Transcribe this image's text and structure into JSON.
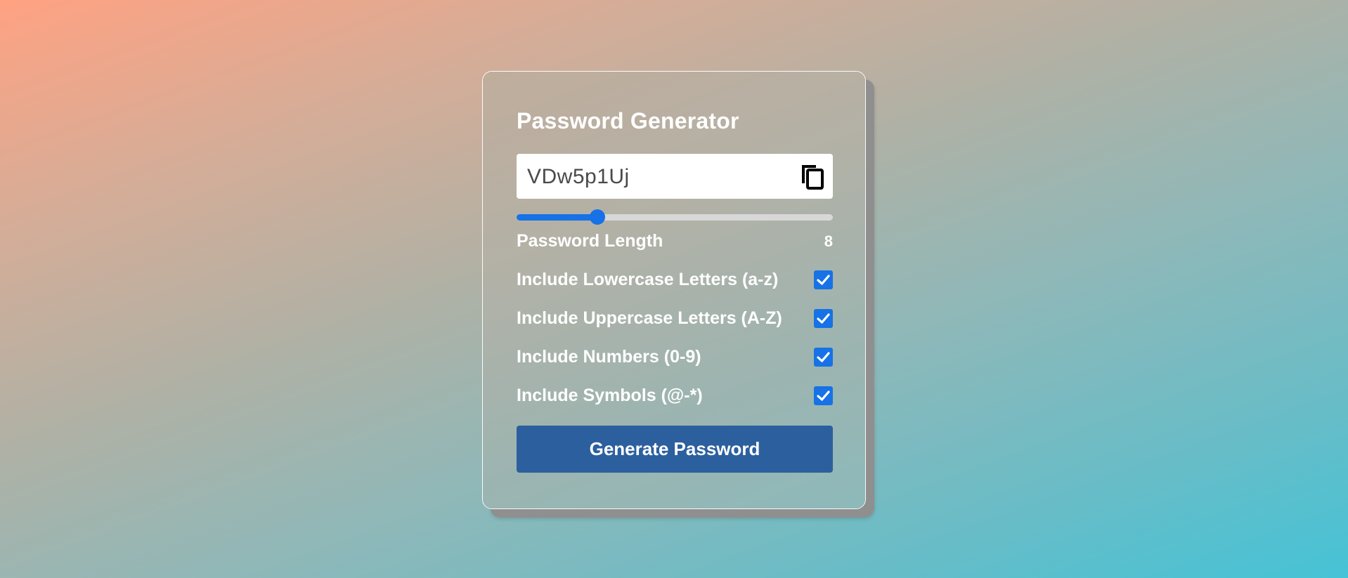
{
  "app": {
    "title": "Password Generator"
  },
  "result": {
    "password": "VDw5p1Uj",
    "copy_icon": "copy-icon"
  },
  "length": {
    "label": "Password Length",
    "value": "8",
    "slider_fraction": 0.255
  },
  "options": [
    {
      "label": "Include Lowercase Letters (a-z)",
      "checked": true
    },
    {
      "label": "Include Uppercase Letters (A-Z)",
      "checked": true
    },
    {
      "label": "Include Numbers (0-9)",
      "checked": true
    },
    {
      "label": "Include Symbols (@-*)",
      "checked": true
    }
  ],
  "actions": {
    "generate_label": "Generate Password"
  },
  "colors": {
    "accent": "#1672e6",
    "button": "#2c5f9e",
    "text": "#ffffff"
  }
}
